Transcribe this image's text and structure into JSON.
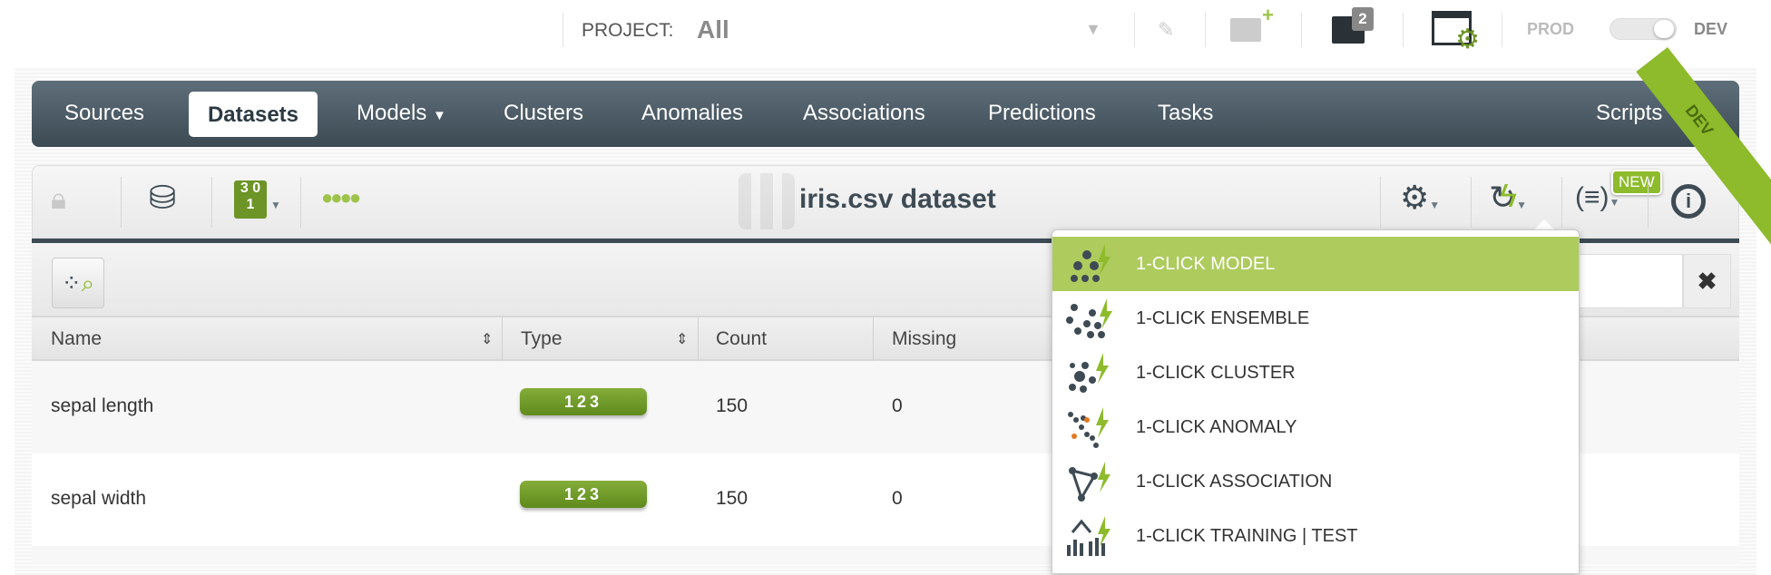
{
  "topbar": {
    "project_label": "PROJECT:",
    "project_value": "All",
    "folder_count": "2",
    "env_prod": "PROD",
    "env_dev": "DEV",
    "ribbon": "DEV"
  },
  "nav": {
    "items": [
      "Sources",
      "Datasets",
      "Models",
      "Clusters",
      "Anomalies",
      "Associations",
      "Predictions",
      "Tasks",
      "Scripts"
    ],
    "active": "Datasets"
  },
  "toolbar": {
    "title": "iris.csv dataset",
    "new_badge": "NEW"
  },
  "table": {
    "columns": [
      "Name",
      "Type",
      "Count",
      "Missing"
    ],
    "rows": [
      {
        "name": "sepal length",
        "type": "123",
        "count": "150",
        "missing": "0"
      },
      {
        "name": "sepal width",
        "type": "123",
        "count": "150",
        "missing": "0"
      }
    ]
  },
  "dropdown": {
    "items": [
      "1-CLICK MODEL",
      "1-CLICK ENSEMBLE",
      "1-CLICK CLUSTER",
      "1-CLICK ANOMALY",
      "1-CLICK ASSOCIATION",
      "1-CLICK TRAINING | TEST"
    ],
    "selected": "1-CLICK MODEL"
  },
  "colors": {
    "accent": "#aecb5e",
    "nav": "#3c4a53",
    "badge": "#6c9426"
  }
}
